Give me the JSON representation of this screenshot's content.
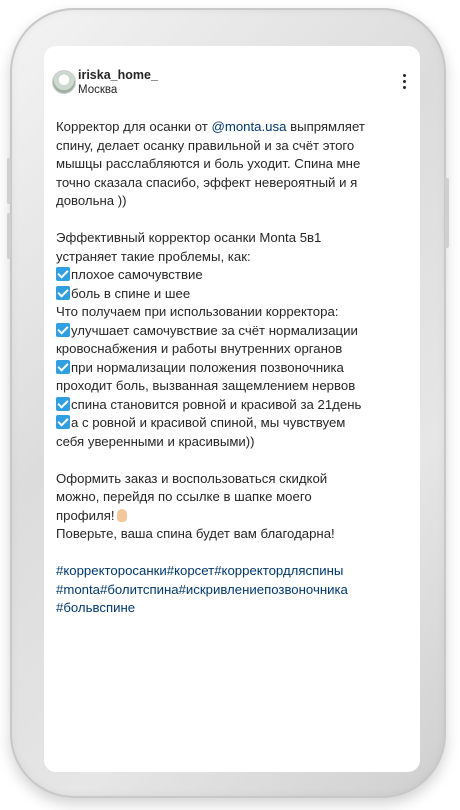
{
  "post": {
    "username": "iriska_home_",
    "location": "Москва",
    "caption": {
      "p1": {
        "l1a": "Корректор для осанки от ",
        "l1mention": "@monta.usa",
        "l1b": " выпрямляет",
        "l2": "спину, делает осанку правильной и за счёт этого",
        "l3": "мышцы расслабляются и боль уходит. Спина мне",
        "l4": "точно сказала спасибо, эффект невероятный и я",
        "l5": "довольна ))"
      },
      "p2": {
        "l1": "Эффективный корректор осанки Monta 5в1",
        "l2": "устраняет такие проблемы, как:",
        "c1": "плохое самочувствие",
        "c2": "боль в спине и шее",
        "l3": "Что получаем при использовании корректора:",
        "c3": "улучшает самочувствие за счёт нормализации",
        "c3b": "кровоснабжения и работы внутренних органов",
        "c4": "при нормализации положения позвоночника",
        "c4b": "проходит боль, вызванная защемлением нервов",
        "c5": "спина становится ровной и красивой за 21день",
        "c6": "а с ровной и красивой спиной, мы чувствуем",
        "c6b": "себя уверенными и красивыми))"
      },
      "p3": {
        "l1": "Оформить заказ и воспользоваться скидкой",
        "l2": "можно, перейдя по ссылке в шапке моего",
        "l3": "профиля!",
        "l4": "Поверьте, ваша спина будет вам благодарна!"
      },
      "hashtags": {
        "l1": "#корректоросанки#корсет#корректордляспины",
        "l2": "#monta#болитспина#искривлениепозвоночника",
        "l3": "#больвспине"
      }
    }
  },
  "icons": {
    "more": "three-dots-vertical-icon",
    "check": "check-mark-button-icon",
    "ok": "ok-hand-icon"
  },
  "colors": {
    "text": "#262626",
    "link": "#00376b",
    "check": "#2f9fe0"
  }
}
